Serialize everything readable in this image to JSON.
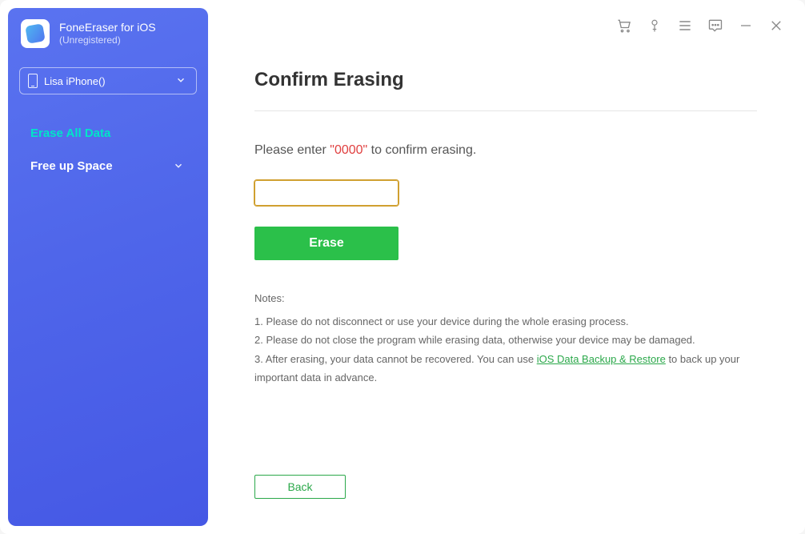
{
  "app": {
    "title": "FoneEraser for iOS",
    "subtitle": "(Unregistered)"
  },
  "device": {
    "name": "Lisa iPhone()"
  },
  "nav": {
    "erase_all": "Erase All Data",
    "free_up": "Free up Space"
  },
  "main": {
    "title": "Confirm Erasing",
    "prompt_before": "Please enter ",
    "prompt_code": "\"0000\"",
    "prompt_after": " to confirm erasing.",
    "erase_button": "Erase",
    "back_button": "Back"
  },
  "notes": {
    "heading": "Notes:",
    "line1": "1. Please do not disconnect or use your device during the whole erasing process.",
    "line2": "2. Please do not close the program while erasing data, otherwise your device may be damaged.",
    "line3_before": "3. After erasing, your data cannot be recovered. You can use ",
    "line3_link": "iOS Data Backup & Restore",
    "line3_after": " to back up your important data in advance."
  }
}
